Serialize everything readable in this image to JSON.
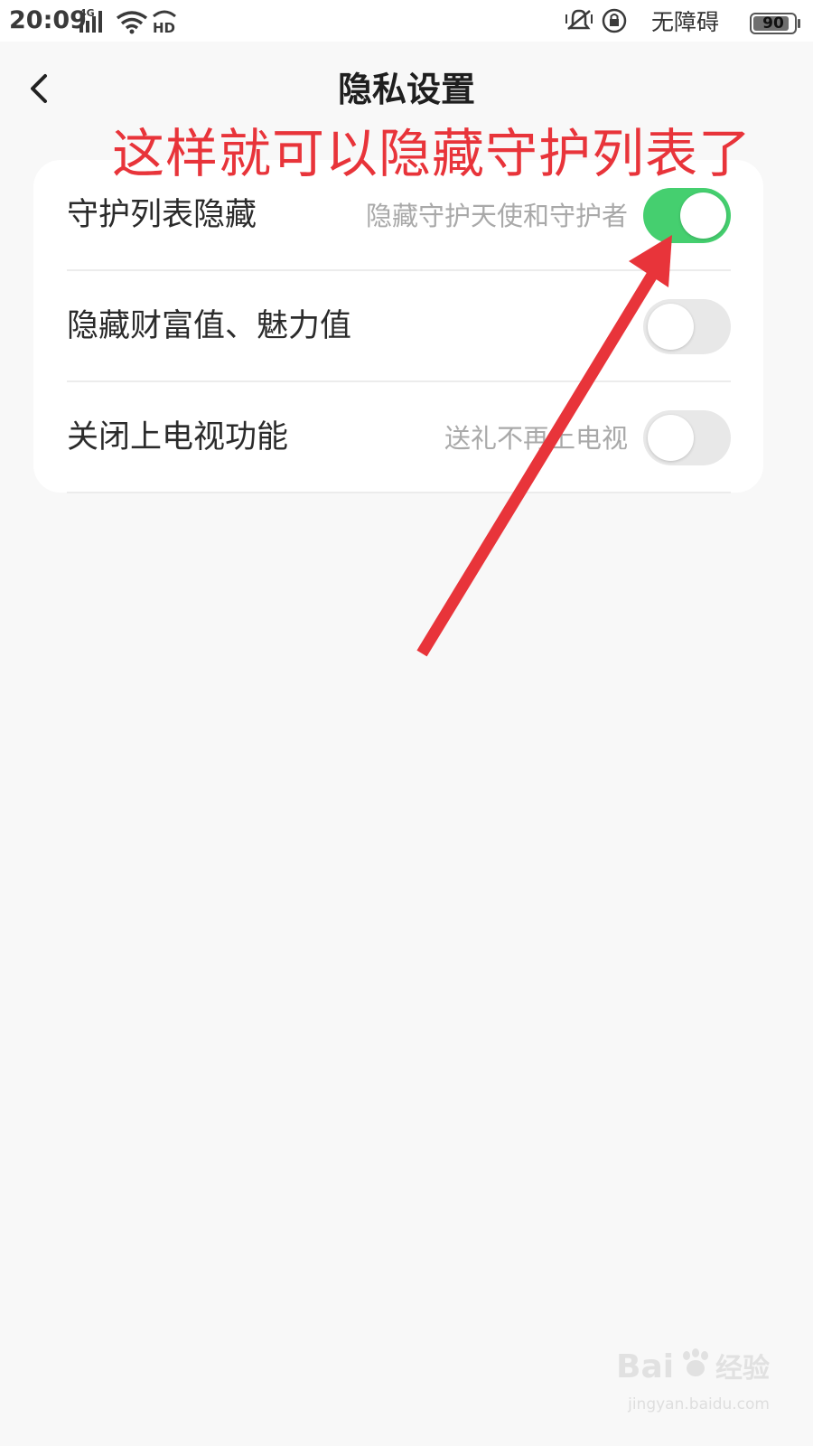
{
  "status_bar": {
    "time": "20:09",
    "network_label": "4G",
    "hd_label": "HD",
    "accessibility_text": "无障碍",
    "battery_level": 90,
    "battery_label": "90"
  },
  "header": {
    "title": "隐私设置"
  },
  "annotation": {
    "text": "这样就可以隐藏守护列表了",
    "color": "#e8343a"
  },
  "settings": {
    "items": [
      {
        "label": "守护列表隐藏",
        "description": "隐藏守护天使和守护者",
        "enabled": true
      },
      {
        "label": "隐藏财富值、魅力值",
        "description": "",
        "enabled": false
      },
      {
        "label": "关闭上电视功能",
        "description": "送礼不再上电视",
        "enabled": false
      }
    ]
  },
  "colors": {
    "toggle_on": "#45cf6f",
    "toggle_off": "#e8e8e8",
    "background": "#f8f8f8"
  },
  "watermark": {
    "url": "jingyan.baidu.com"
  }
}
